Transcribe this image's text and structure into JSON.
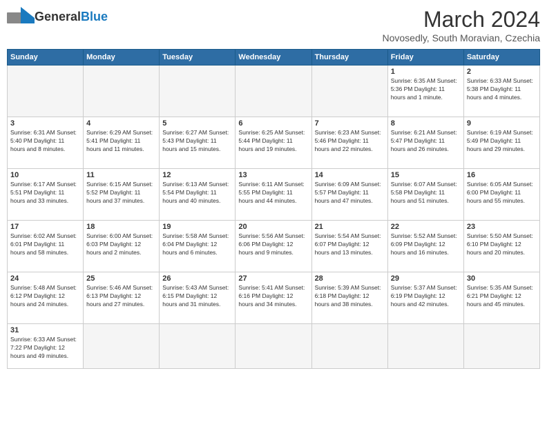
{
  "header": {
    "logo_general": "General",
    "logo_blue": "Blue",
    "month_title": "March 2024",
    "location": "Novosedly, South Moravian, Czechia"
  },
  "days_of_week": [
    "Sunday",
    "Monday",
    "Tuesday",
    "Wednesday",
    "Thursday",
    "Friday",
    "Saturday"
  ],
  "weeks": [
    [
      {
        "day": "",
        "info": ""
      },
      {
        "day": "",
        "info": ""
      },
      {
        "day": "",
        "info": ""
      },
      {
        "day": "",
        "info": ""
      },
      {
        "day": "",
        "info": ""
      },
      {
        "day": "1",
        "info": "Sunrise: 6:35 AM\nSunset: 5:36 PM\nDaylight: 11 hours and 1 minute."
      },
      {
        "day": "2",
        "info": "Sunrise: 6:33 AM\nSunset: 5:38 PM\nDaylight: 11 hours and 4 minutes."
      }
    ],
    [
      {
        "day": "3",
        "info": "Sunrise: 6:31 AM\nSunset: 5:40 PM\nDaylight: 11 hours and 8 minutes."
      },
      {
        "day": "4",
        "info": "Sunrise: 6:29 AM\nSunset: 5:41 PM\nDaylight: 11 hours and 11 minutes."
      },
      {
        "day": "5",
        "info": "Sunrise: 6:27 AM\nSunset: 5:43 PM\nDaylight: 11 hours and 15 minutes."
      },
      {
        "day": "6",
        "info": "Sunrise: 6:25 AM\nSunset: 5:44 PM\nDaylight: 11 hours and 19 minutes."
      },
      {
        "day": "7",
        "info": "Sunrise: 6:23 AM\nSunset: 5:46 PM\nDaylight: 11 hours and 22 minutes."
      },
      {
        "day": "8",
        "info": "Sunrise: 6:21 AM\nSunset: 5:47 PM\nDaylight: 11 hours and 26 minutes."
      },
      {
        "day": "9",
        "info": "Sunrise: 6:19 AM\nSunset: 5:49 PM\nDaylight: 11 hours and 29 minutes."
      }
    ],
    [
      {
        "day": "10",
        "info": "Sunrise: 6:17 AM\nSunset: 5:51 PM\nDaylight: 11 hours and 33 minutes."
      },
      {
        "day": "11",
        "info": "Sunrise: 6:15 AM\nSunset: 5:52 PM\nDaylight: 11 hours and 37 minutes."
      },
      {
        "day": "12",
        "info": "Sunrise: 6:13 AM\nSunset: 5:54 PM\nDaylight: 11 hours and 40 minutes."
      },
      {
        "day": "13",
        "info": "Sunrise: 6:11 AM\nSunset: 5:55 PM\nDaylight: 11 hours and 44 minutes."
      },
      {
        "day": "14",
        "info": "Sunrise: 6:09 AM\nSunset: 5:57 PM\nDaylight: 11 hours and 47 minutes."
      },
      {
        "day": "15",
        "info": "Sunrise: 6:07 AM\nSunset: 5:58 PM\nDaylight: 11 hours and 51 minutes."
      },
      {
        "day": "16",
        "info": "Sunrise: 6:05 AM\nSunset: 6:00 PM\nDaylight: 11 hours and 55 minutes."
      }
    ],
    [
      {
        "day": "17",
        "info": "Sunrise: 6:02 AM\nSunset: 6:01 PM\nDaylight: 11 hours and 58 minutes."
      },
      {
        "day": "18",
        "info": "Sunrise: 6:00 AM\nSunset: 6:03 PM\nDaylight: 12 hours and 2 minutes."
      },
      {
        "day": "19",
        "info": "Sunrise: 5:58 AM\nSunset: 6:04 PM\nDaylight: 12 hours and 6 minutes."
      },
      {
        "day": "20",
        "info": "Sunrise: 5:56 AM\nSunset: 6:06 PM\nDaylight: 12 hours and 9 minutes."
      },
      {
        "day": "21",
        "info": "Sunrise: 5:54 AM\nSunset: 6:07 PM\nDaylight: 12 hours and 13 minutes."
      },
      {
        "day": "22",
        "info": "Sunrise: 5:52 AM\nSunset: 6:09 PM\nDaylight: 12 hours and 16 minutes."
      },
      {
        "day": "23",
        "info": "Sunrise: 5:50 AM\nSunset: 6:10 PM\nDaylight: 12 hours and 20 minutes."
      }
    ],
    [
      {
        "day": "24",
        "info": "Sunrise: 5:48 AM\nSunset: 6:12 PM\nDaylight: 12 hours and 24 minutes."
      },
      {
        "day": "25",
        "info": "Sunrise: 5:46 AM\nSunset: 6:13 PM\nDaylight: 12 hours and 27 minutes."
      },
      {
        "day": "26",
        "info": "Sunrise: 5:43 AM\nSunset: 6:15 PM\nDaylight: 12 hours and 31 minutes."
      },
      {
        "day": "27",
        "info": "Sunrise: 5:41 AM\nSunset: 6:16 PM\nDaylight: 12 hours and 34 minutes."
      },
      {
        "day": "28",
        "info": "Sunrise: 5:39 AM\nSunset: 6:18 PM\nDaylight: 12 hours and 38 minutes."
      },
      {
        "day": "29",
        "info": "Sunrise: 5:37 AM\nSunset: 6:19 PM\nDaylight: 12 hours and 42 minutes."
      },
      {
        "day": "30",
        "info": "Sunrise: 5:35 AM\nSunset: 6:21 PM\nDaylight: 12 hours and 45 minutes."
      }
    ],
    [
      {
        "day": "31",
        "info": "Sunrise: 6:33 AM\nSunset: 7:22 PM\nDaylight: 12 hours and 49 minutes."
      },
      {
        "day": "",
        "info": ""
      },
      {
        "day": "",
        "info": ""
      },
      {
        "day": "",
        "info": ""
      },
      {
        "day": "",
        "info": ""
      },
      {
        "day": "",
        "info": ""
      },
      {
        "day": "",
        "info": ""
      }
    ]
  ]
}
